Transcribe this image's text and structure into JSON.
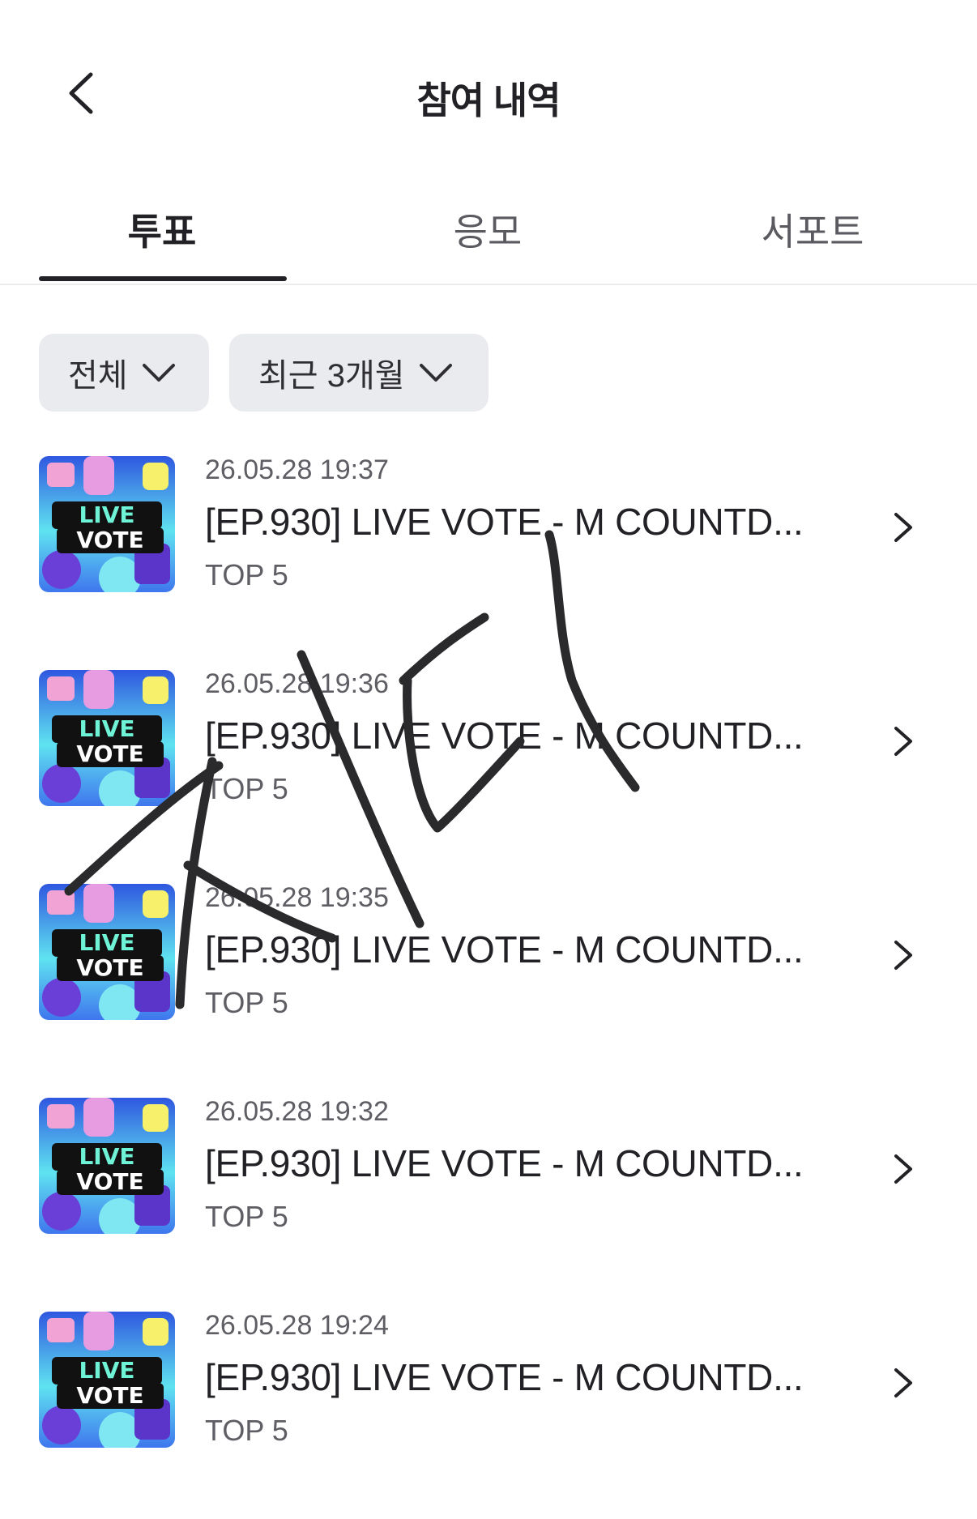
{
  "header": {
    "title": "참여 내역"
  },
  "tabs": [
    {
      "label": "투표",
      "active": true
    },
    {
      "label": "응모",
      "active": false
    },
    {
      "label": "서포트",
      "active": false
    }
  ],
  "filters": {
    "category": "전체",
    "period": "최근 3개월"
  },
  "thumbnail": {
    "text_line1": "LIVE",
    "text_line2": "VOTE"
  },
  "items": [
    {
      "date": "26.05.28 19:37",
      "title": "[EP.930] LIVE VOTE - M COUNTD...",
      "subtitle": "TOP 5"
    },
    {
      "date": "26.05.28 19:36",
      "title": "[EP.930] LIVE VOTE - M COUNTD...",
      "subtitle": "TOP 5"
    },
    {
      "date": "26.05.28 19:35",
      "title": "[EP.930] LIVE VOTE - M COUNTD...",
      "subtitle": "TOP 5"
    },
    {
      "date": "26.05.28 19:32",
      "title": "[EP.930] LIVE VOTE - M COUNTD...",
      "subtitle": "TOP 5"
    },
    {
      "date": "26.05.28 19:24",
      "title": "[EP.930] LIVE VOTE - M COUNTD...",
      "subtitle": "TOP 5"
    }
  ],
  "icons": {
    "back": "chevron-left-icon",
    "dropdown": "chevron-down-icon",
    "row": "chevron-right-icon"
  },
  "colors": {
    "text_primary": "#222226",
    "text_secondary": "#5e5e64",
    "filter_bg": "#eaebee",
    "divider": "#ececee",
    "thumb_bg_top": "#2f57e0",
    "thumb_bg_mid": "#5fe3f0",
    "thumb_accent_pink": "#f2a3d6",
    "thumb_accent_yellow": "#f6f06a"
  }
}
